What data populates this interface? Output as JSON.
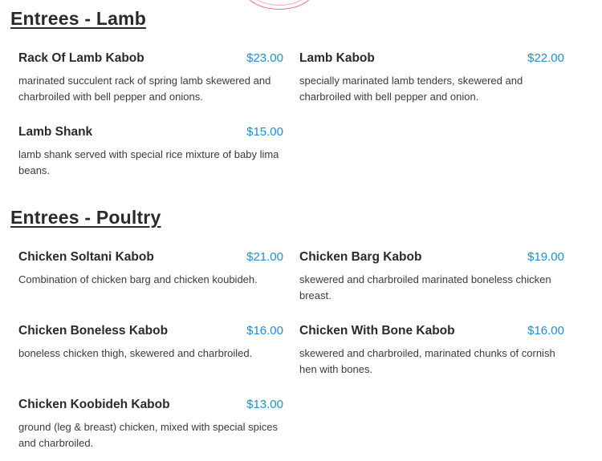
{
  "sections": [
    {
      "title": "Entrees - Lamb",
      "items": [
        {
          "name": "Rack Of Lamb Kabob",
          "price": "$23.00",
          "description": "marinated succulent rack of spring lamb skewered and charbroiled with bell pepper and onions."
        },
        {
          "name": "Lamb Kabob",
          "price": "$22.00",
          "description": "specially marinated lamb tenders, skewered and charbroiled with bell pepper and onion."
        },
        {
          "name": "Lamb Shank",
          "price": "$15.00",
          "description": "lamb shank served with special rice mixture of baby lima beans."
        }
      ]
    },
    {
      "title": "Entrees - Poultry",
      "items": [
        {
          "name": "Chicken Soltani Kabob",
          "price": "$21.00",
          "description": "Combination of chicken barg and chicken koubideh."
        },
        {
          "name": "Chicken Barg Kabob",
          "price": "$19.00",
          "description": "skewered and charbroiled marinated boneless chicken breast."
        },
        {
          "name": "Chicken Boneless Kabob",
          "price": "$16.00",
          "description": "boneless chicken thigh, skewered and charbroiled."
        },
        {
          "name": "Chicken With Bone Kabob",
          "price": "$16.00",
          "description": "skewered and charbroiled, marinated chunks of cornish hen with bones."
        },
        {
          "name": "Chicken Koobideh Kabob",
          "price": "$13.00",
          "description": "ground (leg & breast) chicken, mixed with special spices and charbroiled."
        }
      ]
    }
  ]
}
